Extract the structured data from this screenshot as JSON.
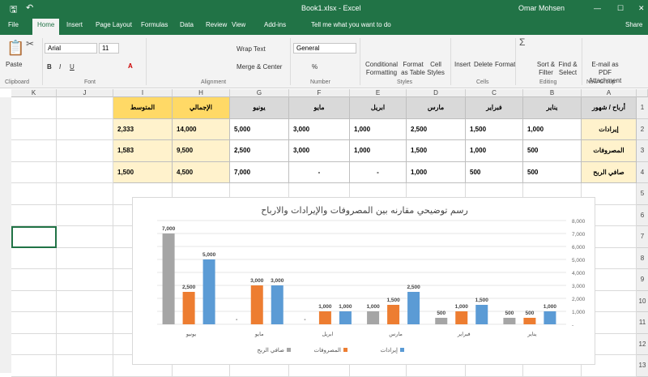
{
  "window": {
    "title": "Book1.xlsx - Excel",
    "user": "Omar Mohsen",
    "share": "Share"
  },
  "tabs": [
    "File",
    "Home",
    "Insert",
    "Page Layout",
    "Formulas",
    "Data",
    "Review",
    "View",
    "Add-ins"
  ],
  "tell_me": "Tell me what you want to do",
  "ribbon": {
    "paste": "Paste",
    "font_name": "Arial",
    "font_size": "11",
    "wrap_text": "Wrap Text",
    "merge_center": "Merge & Center",
    "number_format": "General",
    "conditional": "Conditional Formatting",
    "format_table": "Format as Table",
    "cell_styles": "Cell Styles",
    "insert": "Insert",
    "delete": "Delete",
    "format": "Format",
    "sort_filter": "Sort & Filter",
    "find_select": "Find & Select",
    "email_pdf": "E-mail as PDF Attachment",
    "groups": [
      "Clipboard",
      "Font",
      "Alignment",
      "Number",
      "Styles",
      "Cells",
      "Editing",
      "New Group"
    ]
  },
  "columns": [
    "A",
    "B",
    "C",
    "D",
    "E",
    "F",
    "G",
    "H",
    "I",
    "J",
    "K"
  ],
  "rows": [
    "1",
    "2",
    "3",
    "4",
    "5",
    "6",
    "7",
    "8",
    "9",
    "10",
    "11",
    "12",
    "13"
  ],
  "table": [
    [
      "أرباح / شهور",
      "يناير",
      "فبراير",
      "مارس",
      "ابريل",
      "مايو",
      "يونيو",
      "الإجمالي",
      "المتوسط"
    ],
    [
      "إيرادات",
      "1,000",
      "1,500",
      "2,500",
      "1,000",
      "3,000",
      "5,000",
      "14,000",
      "2,333"
    ],
    [
      "المصروفات",
      "500",
      "1,000",
      "1,500",
      "1,000",
      "3,000",
      "2,500",
      "9,500",
      "1,583"
    ],
    [
      "صافي الربح",
      "500",
      "500",
      "1,000",
      "-",
      "-",
      "7,000",
      "4,500",
      "1,500"
    ]
  ],
  "colors": {
    "brand": "#217346",
    "header_gray": "#d9d9d9",
    "label_yellow": "#fff2cc",
    "total_yellow": "#ffd966",
    "blue": "#5b9bd5",
    "orange": "#ed7d31",
    "gray": "#a5a5a5"
  },
  "chart_data": {
    "type": "bar",
    "title": "رسم توضيحي مقارنه بين المصروفات والإيرادات والارباح",
    "categories": [
      "يناير",
      "فبراير",
      "مارس",
      "ابريل",
      "مايو",
      "يونيو"
    ],
    "series": [
      {
        "name": "إيرادات",
        "color": "#5b9bd5",
        "values": [
          1000,
          1500,
          2500,
          1000,
          3000,
          5000
        ]
      },
      {
        "name": "المصروفات",
        "color": "#ed7d31",
        "values": [
          500,
          1000,
          1500,
          1000,
          3000,
          2500
        ]
      },
      {
        "name": "صافي الربح",
        "color": "#a5a5a5",
        "values": [
          500,
          500,
          1000,
          0,
          0,
          7000
        ]
      }
    ],
    "ylim": [
      0,
      8000
    ],
    "yticks": [
      "-",
      "1,000",
      "2,000",
      "3,000",
      "4,000",
      "5,000",
      "6,000",
      "7,000",
      "8,000"
    ],
    "axis_position": "right",
    "direction": "right-to-left",
    "grid": true,
    "legend": "bottom"
  }
}
